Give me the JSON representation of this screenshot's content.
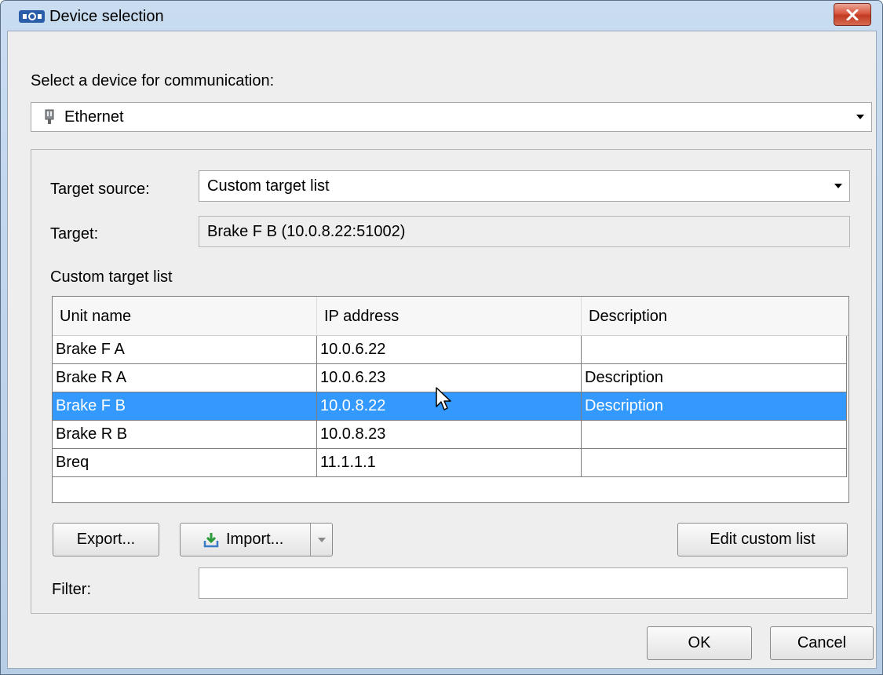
{
  "window": {
    "title": "Device selection"
  },
  "device": {
    "prompt": "Select a device for communication:",
    "selected": "Ethernet"
  },
  "target": {
    "source_label": "Target source:",
    "source_value": "Custom target list",
    "target_label": "Target:",
    "target_value": "Brake F B (10.0.8.22:51002)",
    "list_label": "Custom target list"
  },
  "table": {
    "columns": [
      "Unit name",
      "IP address",
      "Description"
    ],
    "rows": [
      {
        "unit": "Brake F A",
        "ip": "10.0.6.22",
        "description": ""
      },
      {
        "unit": "Brake R A",
        "ip": "10.0.6.23",
        "description": "Description"
      },
      {
        "unit": "Brake F B",
        "ip": "10.0.8.22",
        "description": "Description"
      },
      {
        "unit": "Brake R B",
        "ip": "10.0.8.23",
        "description": ""
      },
      {
        "unit": "Breq",
        "ip": "11.1.1.1",
        "description": ""
      }
    ],
    "selected_row": 2
  },
  "buttons": {
    "export": "Export...",
    "import": "Import...",
    "edit": "Edit custom list",
    "ok": "OK",
    "cancel": "Cancel"
  },
  "filter": {
    "label": "Filter:",
    "value": ""
  },
  "colors": {
    "selection": "#3399ff",
    "title_bar": "#c9dcf0",
    "close_button": "#c8452c"
  },
  "icons": {
    "app": "app-logo-icon",
    "ethernet": "ethernet-plug-icon",
    "import": "download-arrow-icon",
    "close": "close-icon",
    "dropdown": "chevron-down-icon"
  }
}
